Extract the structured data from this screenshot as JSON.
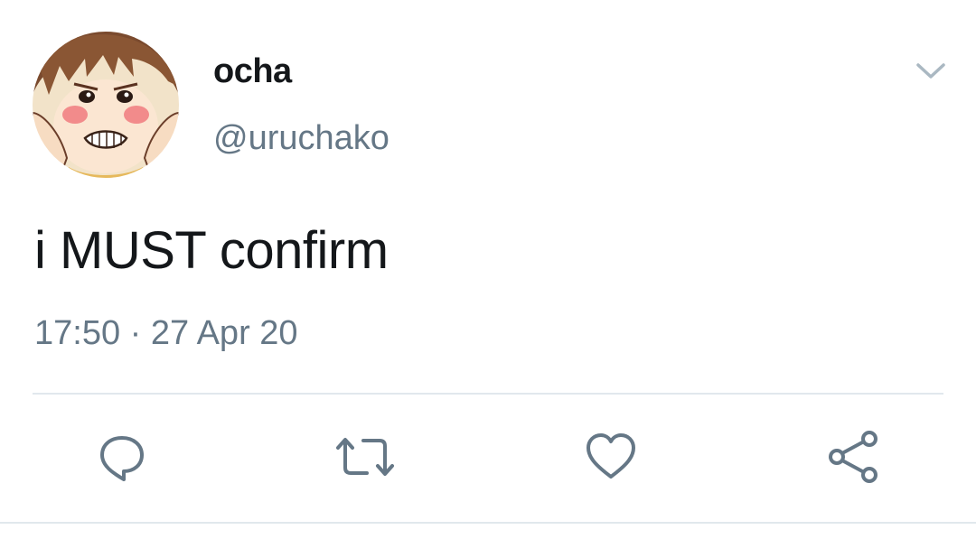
{
  "tweet": {
    "display_name": "ocha",
    "handle": "@uruchako",
    "text": "i MUST confirm",
    "timestamp": "17:50 · 27 Apr 20"
  },
  "icons": {
    "menu": "chevron-down-icon",
    "reply": "reply-icon",
    "retweet": "retweet-icon",
    "like": "heart-icon",
    "share": "share-icon"
  },
  "colors": {
    "text": "#14171a",
    "secondary": "#657786",
    "divider": "#e1e8ed"
  }
}
